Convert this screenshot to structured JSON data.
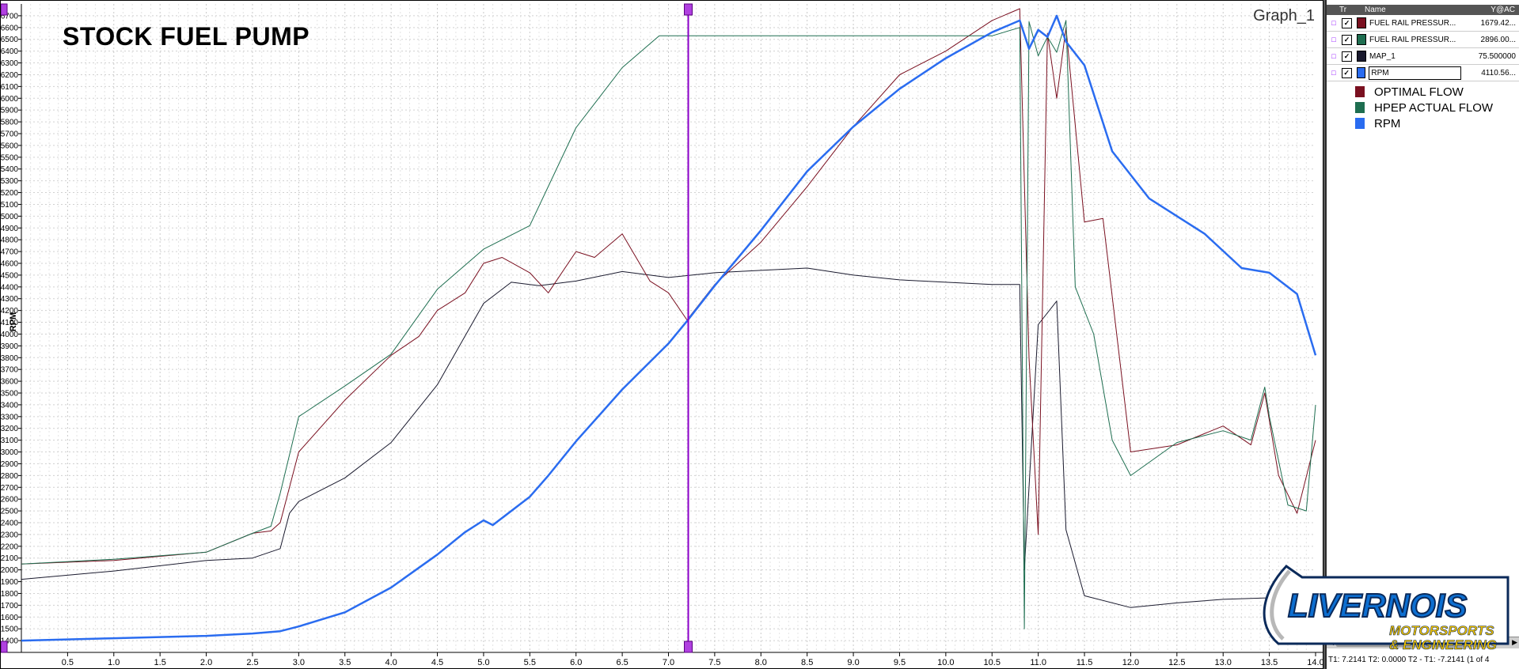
{
  "graph": {
    "title": "STOCK FUEL PUMP",
    "name": "Graph_1",
    "y_axis_label": "RPM"
  },
  "channels": {
    "header": {
      "tr": "Tr",
      "name": "Name",
      "value": "Y@AC"
    },
    "rows": [
      {
        "name": "FUEL RAIL PRESSUR...",
        "value": "1679.42...",
        "color": "#7a1020"
      },
      {
        "name": "FUEL RAIL PRESSUR...",
        "value": "2896.00...",
        "color": "#1e6e50"
      },
      {
        "name": "MAP_1",
        "value": "75.500000",
        "color": "#1a1a2e"
      },
      {
        "name": "RPM",
        "value": "4110.56...",
        "color": "#2a6cf0"
      }
    ]
  },
  "legend": [
    {
      "label": "OPTIMAL FLOW",
      "color": "#7a1020"
    },
    {
      "label": "HPEP ACTUAL FLOW",
      "color": "#1e6e50"
    },
    {
      "label": "RPM",
      "color": "#2a6cf0"
    }
  ],
  "cursor_readout": "T1: 7.2141   T2: 0.0000   T2 - T1: -7.2141   (1 of 4",
  "logo": {
    "line1": "LIVERNOIS",
    "line2": "MOTORSPORTS",
    "line3": "& ENGINEERING"
  },
  "chart_data": {
    "type": "line",
    "xlim": [
      0,
      14
    ],
    "ylim": [
      1300,
      6800
    ],
    "x_ticks": [
      "0.5",
      "1.0",
      "1.5",
      "2.0",
      "2.5",
      "3.0",
      "3.5",
      "4.0",
      "4.5",
      "5.0",
      "5.5",
      "6.0",
      "6.5",
      "7.0",
      "7.5",
      "8.0",
      "8.5",
      "9.0",
      "9.5",
      "10.0",
      "10.5",
      "11.0",
      "11.5",
      "12.0",
      "12.5",
      "13.0",
      "13.5",
      "14.0"
    ],
    "y_ticks": [
      "1400",
      "1500",
      "1600",
      "1700",
      "1800",
      "1900",
      "2000",
      "2100",
      "2200",
      "2300",
      "2400",
      "2500",
      "2600",
      "2700",
      "2800",
      "2900",
      "3000",
      "3100",
      "3200",
      "3300",
      "3400",
      "3500",
      "3600",
      "3700",
      "3800",
      "3900",
      "4000",
      "4100",
      "4200",
      "4300",
      "4400",
      "4500",
      "4600",
      "4700",
      "4800",
      "4900",
      "5000",
      "5100",
      "5200",
      "5300",
      "5400",
      "5500",
      "5600",
      "5700",
      "5800",
      "5900",
      "6000",
      "6100",
      "6200",
      "6300",
      "6400",
      "6500",
      "6600",
      "6700"
    ],
    "cursor_x": 7.2141,
    "series": [
      {
        "name": "RPM",
        "color": "#2a6cf0",
        "width": 2.5,
        "x": [
          0,
          1,
          2,
          2.5,
          2.8,
          3,
          3.5,
          4,
          4.5,
          4.8,
          5,
          5.1,
          5.5,
          5.7,
          6,
          6.5,
          7,
          7.2,
          7.5,
          8,
          8.5,
          9,
          9.5,
          10,
          10.5,
          10.8,
          10.9,
          11,
          11.1,
          11.2,
          11.3,
          11.5,
          11.8,
          12.2,
          12.8,
          13.2,
          13.5,
          13.8,
          14
        ],
        "y": [
          1400,
          1420,
          1440,
          1460,
          1480,
          1520,
          1640,
          1850,
          2130,
          2320,
          2420,
          2380,
          2620,
          2800,
          3090,
          3530,
          3920,
          4110,
          4410,
          4880,
          5380,
          5760,
          6080,
          6340,
          6560,
          6660,
          6420,
          6580,
          6520,
          6700,
          6480,
          6280,
          5550,
          5150,
          4850,
          4560,
          4520,
          4340,
          3820
        ]
      },
      {
        "name": "HPEP ACTUAL FLOW",
        "color": "#1e6e50",
        "width": 1,
        "x": [
          0,
          1,
          2,
          2.5,
          2.7,
          2.8,
          3,
          3.5,
          4,
          4.5,
          5,
          5.5,
          6,
          6.5,
          6.9,
          7.2,
          7.5,
          8,
          9,
          10,
          10.5,
          10.8,
          10.85,
          10.9,
          11,
          11.1,
          11.2,
          11.3,
          11.4,
          11.6,
          11.8,
          12,
          12.5,
          13,
          13.3,
          13.45,
          13.5,
          13.7,
          13.9,
          14
        ],
        "y": [
          2050,
          2090,
          2150,
          2310,
          2370,
          2650,
          3300,
          3560,
          3830,
          4380,
          4720,
          4920,
          5750,
          6260,
          6530,
          6530,
          6530,
          6530,
          6530,
          6530,
          6530,
          6600,
          1500,
          6650,
          6360,
          6520,
          6390,
          6660,
          4400,
          4000,
          3100,
          2800,
          3080,
          3180,
          3100,
          3550,
          3300,
          2550,
          2500,
          3400
        ]
      },
      {
        "name": "OPTIMAL FLOW",
        "color": "#7a1020",
        "width": 1,
        "x": [
          0,
          1,
          2,
          2.5,
          2.7,
          2.8,
          3,
          3.5,
          4,
          4.3,
          4.5,
          4.8,
          5,
          5.2,
          5.5,
          5.7,
          6,
          6.2,
          6.5,
          6.8,
          7,
          7.2,
          7.5,
          8,
          8.5,
          9,
          9.5,
          10,
          10.5,
          10.8,
          10.9,
          11,
          11.1,
          11.2,
          11.3,
          11.5,
          11.7,
          12,
          12.5,
          13,
          13.3,
          13.45,
          13.6,
          13.8,
          14
        ],
        "y": [
          2050,
          2080,
          2150,
          2310,
          2330,
          2400,
          3000,
          3440,
          3820,
          3980,
          4200,
          4350,
          4600,
          4650,
          4520,
          4350,
          4700,
          4650,
          4850,
          4450,
          4350,
          4120,
          4420,
          4780,
          5250,
          5760,
          6200,
          6400,
          6660,
          6760,
          3800,
          2300,
          6550,
          6000,
          6600,
          4950,
          4980,
          3000,
          3060,
          3220,
          3060,
          3500,
          2800,
          2480,
          3100
        ]
      },
      {
        "name": "MAP_1",
        "color": "#1a1a2e",
        "width": 1,
        "x": [
          0,
          1,
          2,
          2.5,
          2.8,
          2.9,
          3,
          3.5,
          4,
          4.5,
          5,
          5.3,
          5.6,
          6,
          6.5,
          7,
          7.5,
          8,
          8.5,
          9,
          9.5,
          10,
          10.5,
          10.8,
          10.85,
          11,
          11.2,
          11.3,
          11.5,
          12,
          12.5,
          13,
          13.4,
          13.8,
          14
        ],
        "y": [
          1920,
          1990,
          2080,
          2100,
          2180,
          2480,
          2580,
          2780,
          3080,
          3570,
          4260,
          4440,
          4410,
          4450,
          4530,
          4480,
          4520,
          4540,
          4560,
          4500,
          4460,
          4440,
          4420,
          4420,
          2000,
          4080,
          4280,
          2340,
          1780,
          1680,
          1720,
          1750,
          1760,
          1770,
          1780
        ]
      }
    ]
  }
}
